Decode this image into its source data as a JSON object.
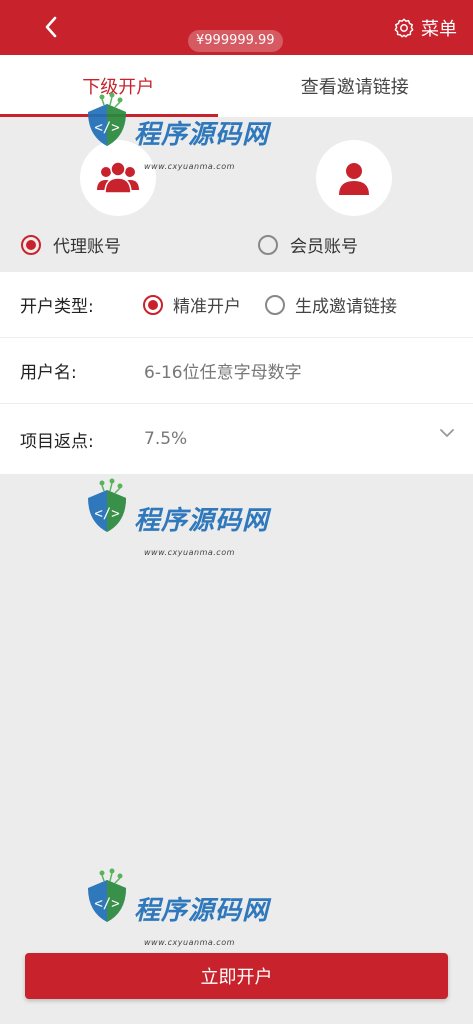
{
  "header": {
    "balance": "¥999999.99",
    "menu_label": "菜单"
  },
  "tabs": [
    {
      "label": "下级开户",
      "active": true
    },
    {
      "label": "查看邀请链接",
      "active": false
    }
  ],
  "account_types": [
    {
      "label": "代理账号",
      "icon": "group-user-icon",
      "checked": true
    },
    {
      "label": "会员账号",
      "icon": "single-user-icon",
      "checked": false
    }
  ],
  "form": {
    "open_type": {
      "label": "开户类型:",
      "options": [
        {
          "label": "精准开户",
          "checked": true
        },
        {
          "label": "生成邀请链接",
          "checked": false
        }
      ]
    },
    "username": {
      "label": "用户名:",
      "placeholder": "6-16位任意字母数字"
    },
    "rebate": {
      "label": "项目返点:",
      "value": "7.5%"
    }
  },
  "watermark": {
    "brand": "程序源码网",
    "url": "www.cxyuanma.com"
  },
  "submit_label": "立即开户",
  "colors": {
    "accent": "#c8232d",
    "background": "#ececec"
  }
}
